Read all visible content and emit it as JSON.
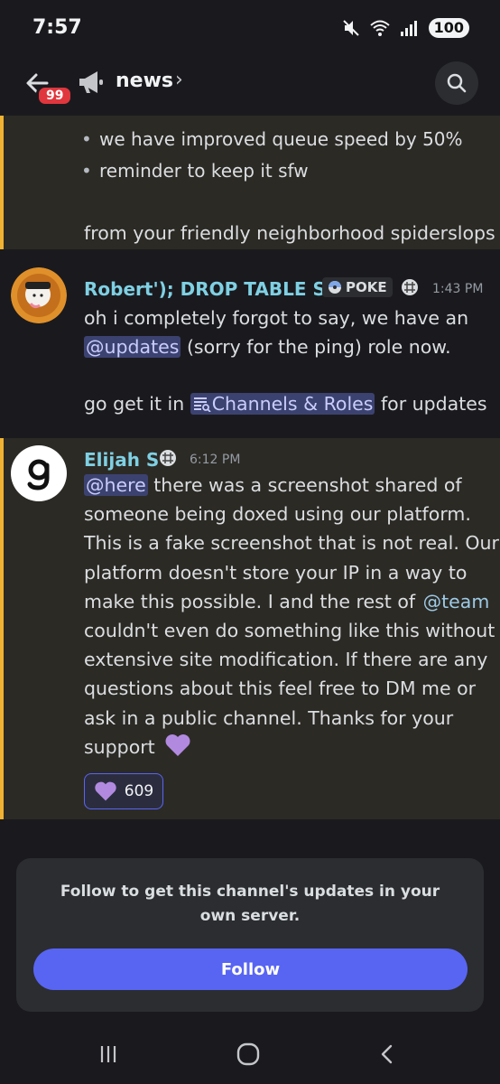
{
  "status_bar": {
    "time": "7:57",
    "battery": "100",
    "wifi_band": "5"
  },
  "header": {
    "badge": "99",
    "channel_name": "news",
    "chevron": "›"
  },
  "messages": [
    {
      "bullets": [
        "we have improved queue speed by 50%",
        "reminder to keep it sfw"
      ],
      "footer": "from your friendly neighborhood spiderslops"
    },
    {
      "author": "Robert'); DROP TABLE S...",
      "author_color": "#7fd0e3",
      "role_tag": "POKE",
      "timestamp": "1:43 PM",
      "line1": "oh i completely forgot to say, we have an",
      "mention": "@updates",
      "line2_rest": " (sorry for the ping) role now.",
      "line3_prefix": "go get it in ",
      "channel_link": "Channels & Roles",
      "line3_suffix": " for updates"
    },
    {
      "author": "Elijah S",
      "author_color": "#7fd0e3",
      "timestamp": "6:12 PM",
      "mention_here": "@here",
      "line1_rest": " there was a screenshot shared of",
      "line2": "someone being doxed using our platform.",
      "line3": "This is a fake screenshot that is not real. Our",
      "line4": "platform doesn't store your IP in a way to",
      "line5": "make this possible. I and the rest of ",
      "mention_team": "@team",
      "line6": "couldn't even do something like this without",
      "line7": "extensive site modification. If there are any",
      "line8": "questions about this feel free to DM me or",
      "line9": "ask in a public channel. Thanks for your",
      "line10": "support",
      "reaction_count": "609",
      "avatar_letter": "g"
    }
  ],
  "follow_card": {
    "text": "Follow to get this channel's updates in your own server.",
    "button": "Follow"
  },
  "nav": {
    "recents": "recents-icon",
    "home": "home-icon",
    "back": "back-icon"
  }
}
